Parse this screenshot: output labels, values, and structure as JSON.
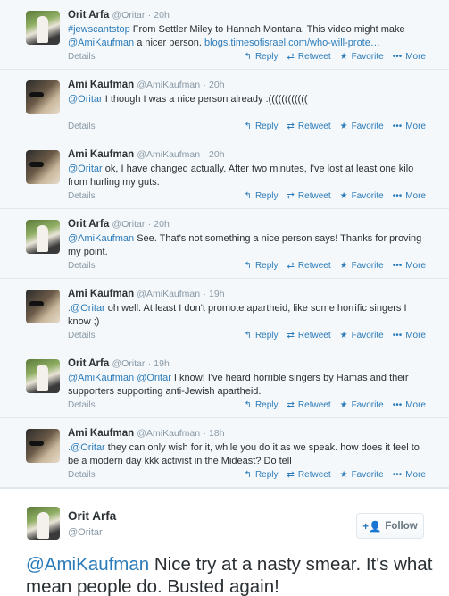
{
  "actions": {
    "details": "Details",
    "reply": "Reply",
    "retweet": "Retweet",
    "favorite": "Favorite",
    "more": "More",
    "reply_icon": "↰",
    "retweet_icon": "⇄",
    "favorite_icon": "★",
    "more_icon": "•••"
  },
  "tweets": [
    {
      "name": "Orit Arfa",
      "handle": "@Oritar",
      "time": "20h",
      "avatar": "orit-avatar",
      "lead": "#jewscantstop",
      "text": " From Settler Miley to Hannah Montana. This video might make ",
      "mention": "@AmiKaufman",
      "text2": " a nicer person. ",
      "link": "blogs.timesofisrael.com/who-will-prote…"
    },
    {
      "name": "Ami Kaufman",
      "handle": "@AmiKaufman",
      "time": "20h",
      "avatar": "ami-avatar",
      "lead": "@Oritar",
      "text": " I though I was a nice person already :(((((((((((("
    },
    {
      "name": "Ami Kaufman",
      "handle": "@AmiKaufman",
      "time": "20h",
      "avatar": "ami-avatar",
      "lead": "@Oritar",
      "text": " ok, I have changed actually. After two minutes, I've lost at least one kilo from hurling my guts."
    },
    {
      "name": "Orit Arfa",
      "handle": "@Oritar",
      "time": "20h",
      "avatar": "orit-avatar",
      "lead": "@AmiKaufman",
      "text": " See. That's not something a nice person says! Thanks for proving my point."
    },
    {
      "name": "Ami Kaufman",
      "handle": "@AmiKaufman",
      "time": "19h",
      "avatar": "ami-avatar",
      "lead": ".@Oritar",
      "text": " oh well. At least I don't promote apartheid, like some horrific singers I know ;)"
    },
    {
      "name": "Orit Arfa",
      "handle": "@Oritar",
      "time": "19h",
      "avatar": "orit-avatar",
      "lead": "@AmiKaufman @Oritar",
      "text": " I know! I've heard horrible singers by Hamas and their supporters supporting anti-Jewish apartheid."
    },
    {
      "name": "Ami Kaufman",
      "handle": "@AmiKaufman",
      "time": "18h",
      "avatar": "ami-avatar",
      "lead": ".@Oritar",
      "text": " they can only wish for it, while you do it as we speak. how does it feel to be a modern day kkk activist in the Mideast? Do tell"
    }
  ],
  "expanded": {
    "name": "Orit Arfa",
    "handle": "@Oritar",
    "follow_label": "Follow",
    "follow_icon": "+👤",
    "mention": "@AmiKaufman",
    "text": " Nice try at a nasty smear. It's what mean people do. Busted again!"
  },
  "colors": {
    "accent": "#2b7bb9",
    "muted": "#8899a6",
    "text": "#292f33",
    "bg": "#f5f8fa"
  }
}
